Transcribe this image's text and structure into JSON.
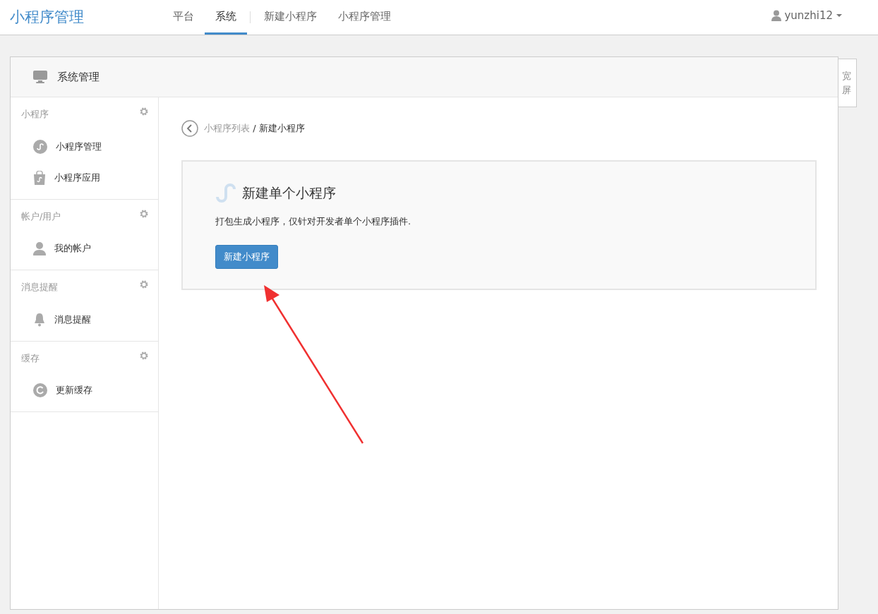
{
  "brand": "小程序管理",
  "nav_tabs": [
    {
      "label": "平台",
      "selected": false
    },
    {
      "label": "系统",
      "selected": true
    },
    {
      "label": "新建小程序",
      "selected": false
    },
    {
      "label": "小程序管理",
      "selected": false
    }
  ],
  "user": {
    "name": "yunzhi12"
  },
  "panel": {
    "title": "系统管理"
  },
  "wide_toggle": "宽屏",
  "sidebar": [
    {
      "title": "小程序",
      "items": [
        {
          "label": "小程序管理",
          "kind": "miniapp"
        },
        {
          "label": "小程序应用",
          "kind": "bag"
        }
      ]
    },
    {
      "title": "帐户/用户",
      "items": [
        {
          "label": "我的帐户",
          "kind": "user"
        }
      ]
    },
    {
      "title": "消息提醒",
      "items": [
        {
          "label": "消息提醒",
          "kind": "bell"
        }
      ]
    },
    {
      "title": "缓存",
      "items": [
        {
          "label": "更新缓存",
          "kind": "refresh"
        }
      ]
    }
  ],
  "breadcrumb": {
    "parent": "小程序列表",
    "separator": "/",
    "current": "新建小程序"
  },
  "card": {
    "title": "新建单个小程序",
    "description": "打包生成小程序，仅针对开发者单个小程序插件.",
    "button": "新建小程序"
  }
}
